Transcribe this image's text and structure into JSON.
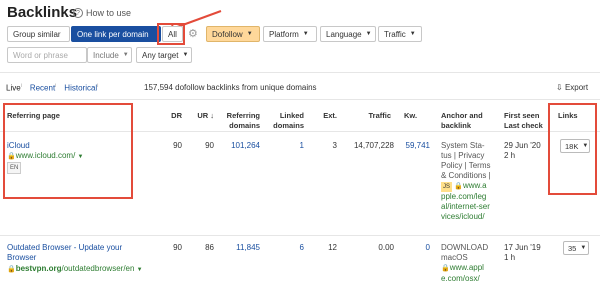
{
  "header": {
    "title": "Backlinks",
    "how_to_use": "How to use"
  },
  "filters": {
    "group_similar": "Group similar",
    "one_link_per_domain": "One link per domain",
    "all": "All",
    "dofollow": "Dofollow",
    "platform": "Platform",
    "language": "Language",
    "traffic": "Traffic",
    "word_placeholder": "Word or phrase",
    "include": "Include",
    "any_target": "Any target"
  },
  "tabs": {
    "live": "Live",
    "recent": "Recent",
    "historical": "Historical"
  },
  "summary": "157,594 dofollow backlinks from unique domains",
  "export": "Export",
  "columns": {
    "referring_page": "Referring page",
    "dr": "DR",
    "ur": "UR ↓",
    "referring_domains_1": "Referring",
    "referring_domains_2": "domains",
    "linked_domains_1": "Linked",
    "linked_domains_2": "domains",
    "ext": "Ext.",
    "traffic": "Traffic",
    "kw": "Kw.",
    "anchor_1": "Anchor and",
    "anchor_2": "backlink",
    "first_seen_1": "First seen",
    "first_seen_2": "Last check",
    "links": "Links"
  },
  "rows": [
    {
      "title": "iCloud",
      "url_domain": "www.icloud.com/",
      "lang": "EN",
      "dr": "90",
      "ur": "90",
      "ref_domains": "101,264",
      "linked_domains": "1",
      "ext": "3",
      "traffic": "14,707,228",
      "kw": "59,741",
      "anchor_lines": [
        "System Sta-",
        "tus | Privacy",
        "Policy | Terms",
        "& Conditions |"
      ],
      "js": "JS",
      "backlink_lines": [
        "www.a",
        "pple.com/leg",
        "al/internet-ser",
        "vices/icloud/"
      ],
      "first_seen": "29 Jun '20",
      "last_check": "2 h",
      "links": "18K"
    },
    {
      "title_lines": [
        "Outdated Browser - Update your",
        "Browser"
      ],
      "url_domain": "bestvpn.org",
      "url_path": "/outdatedbrowser/en",
      "dr": "90",
      "ur": "86",
      "ref_domains": "11,845",
      "linked_domains": "6",
      "ext": "12",
      "traffic": "0.00",
      "kw": "0",
      "anchor_lines": [
        "DOWNLOAD",
        "macOS"
      ],
      "backlink_lines": [
        "www.appl",
        "e.com/osx/"
      ],
      "first_seen": "17 Jun '19",
      "last_check": "1 h",
      "links": "35"
    }
  ],
  "colors": {
    "accent": "#1a4fa0",
    "highlight": "#e34b3a",
    "dofollow_bg": "#ffd89a",
    "green": "#2e7d32"
  }
}
